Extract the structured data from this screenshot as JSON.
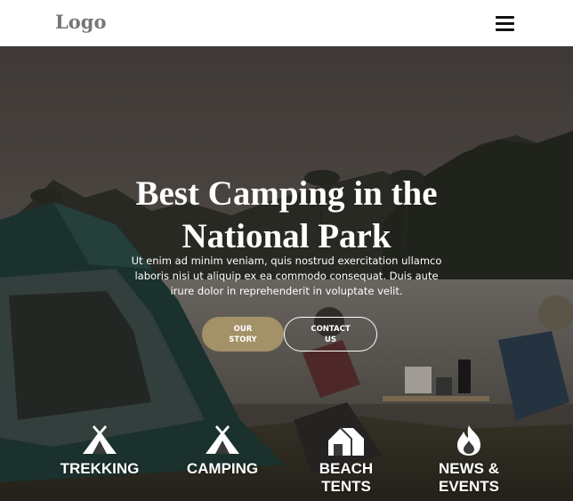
{
  "header": {
    "logo": "Logo",
    "menu_icon": "hamburger-menu-icon"
  },
  "hero": {
    "title_line1": "Best Camping in the",
    "title_line2": "National Park",
    "text_line1": "Ut enim ad minim veniam, quis nostrud exercitation ullamco",
    "text_line2": "laboris nisi ut aliquip ex ea commodo consequat. Duis aute",
    "text_line3": "irure dolor in reprehenderit in voluptate velit.",
    "primary_button": {
      "line1": "OUR",
      "line2": "STORY"
    },
    "secondary_button": {
      "line1": "CONTACT",
      "line2": "US"
    }
  },
  "features": [
    {
      "icon": "tent-icon",
      "line1": "TREKKING",
      "line2": ""
    },
    {
      "icon": "tent-icon",
      "line1": "CAMPING",
      "line2": ""
    },
    {
      "icon": "house-icon",
      "line1": "BEACH",
      "line2": "TENTS"
    },
    {
      "icon": "fire-icon",
      "line1": "NEWS &",
      "line2": "EVENTS"
    }
  ],
  "colors": {
    "accent": "#a39167",
    "text_on_hero": "#ffffff",
    "logo": "#777777"
  }
}
